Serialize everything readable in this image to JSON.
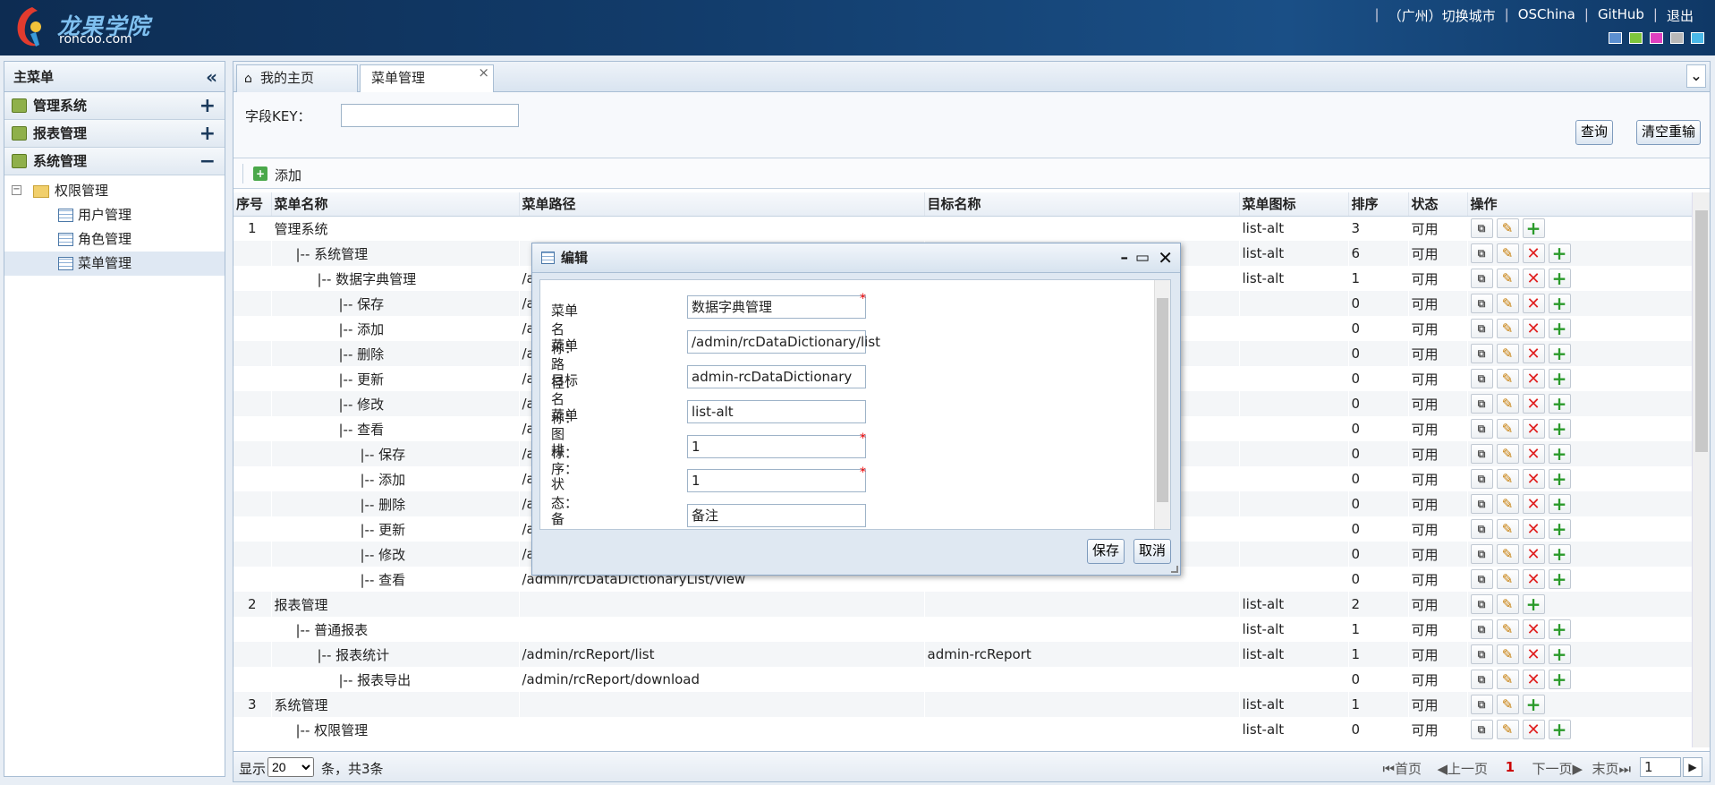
{
  "header": {
    "logo_cn": "龙果学院",
    "logo_en": "roncoo.com",
    "nav": [
      "（广州）切换城市",
      "OSChina",
      "GitHub",
      "退出"
    ],
    "theme_colors": [
      "#5b8fd0",
      "#7ec63c",
      "#e040c0",
      "#b8b8b8",
      "#4ab8e8"
    ]
  },
  "sidebar": {
    "title": "主菜单",
    "groups": [
      {
        "label": "管理系统",
        "toggle": "+"
      },
      {
        "label": "报表管理",
        "toggle": "+"
      },
      {
        "label": "系统管理",
        "toggle": "−"
      }
    ],
    "tree": {
      "root": "权限管理",
      "children": [
        "用户管理",
        "角色管理",
        "菜单管理"
      ]
    }
  },
  "tabs": [
    {
      "label": "我的主页"
    },
    {
      "label": "菜单管理",
      "close": "×"
    }
  ],
  "search": {
    "field_label": "字段KEY：",
    "field_value": "",
    "query_button": "查询",
    "reset_button": "清空重输"
  },
  "toolbar": {
    "add_label": "添加"
  },
  "table": {
    "columns": [
      "序号",
      "菜单名称",
      "菜单路径",
      "目标名称",
      "菜单图标",
      "排序",
      "状态",
      "操作"
    ],
    "rows": [
      {
        "no": "1",
        "name": "管理系统",
        "path": "",
        "target": "",
        "icon": "list-alt",
        "sort": "3",
        "status": "可用",
        "del": false
      },
      {
        "no": "",
        "name": "|-- 系统管理",
        "path": "",
        "target": "",
        "icon": "list-alt",
        "sort": "6",
        "status": "可用",
        "del": true
      },
      {
        "no": "",
        "name": "|-- 数据字典管理",
        "path": "/a",
        "target": "",
        "icon": "list-alt",
        "sort": "1",
        "status": "可用",
        "del": true
      },
      {
        "no": "",
        "name": "|-- 保存",
        "path": "/a",
        "target": "",
        "icon": "",
        "sort": "0",
        "status": "可用",
        "del": true
      },
      {
        "no": "",
        "name": "|-- 添加",
        "path": "/a",
        "target": "",
        "icon": "",
        "sort": "0",
        "status": "可用",
        "del": true
      },
      {
        "no": "",
        "name": "|-- 删除",
        "path": "/a",
        "target": "",
        "icon": "",
        "sort": "0",
        "status": "可用",
        "del": true
      },
      {
        "no": "",
        "name": "|-- 更新",
        "path": "/a",
        "target": "",
        "icon": "",
        "sort": "0",
        "status": "可用",
        "del": true
      },
      {
        "no": "",
        "name": "|-- 修改",
        "path": "/a",
        "target": "",
        "icon": "",
        "sort": "0",
        "status": "可用",
        "del": true
      },
      {
        "no": "",
        "name": "|-- 查看",
        "path": "/a",
        "target": "",
        "icon": "",
        "sort": "0",
        "status": "可用",
        "del": true
      },
      {
        "no": "",
        "name": "|-- 保存",
        "path": "/a",
        "target": "",
        "icon": "",
        "sort": "0",
        "status": "可用",
        "del": true
      },
      {
        "no": "",
        "name": "|-- 添加",
        "path": "/a",
        "target": "",
        "icon": "",
        "sort": "0",
        "status": "可用",
        "del": true
      },
      {
        "no": "",
        "name": "|-- 删除",
        "path": "/a",
        "target": "",
        "icon": "",
        "sort": "0",
        "status": "可用",
        "del": true
      },
      {
        "no": "",
        "name": "|-- 更新",
        "path": "/a",
        "target": "",
        "icon": "",
        "sort": "0",
        "status": "可用",
        "del": true
      },
      {
        "no": "",
        "name": "|-- 修改",
        "path": "/a",
        "target": "",
        "icon": "",
        "sort": "0",
        "status": "可用",
        "del": true
      },
      {
        "no": "",
        "name": "|-- 查看",
        "path": "/admin/rcDataDictionaryList/view",
        "target": "",
        "icon": "",
        "sort": "0",
        "status": "可用",
        "del": true
      },
      {
        "no": "2",
        "name": "报表管理",
        "path": "",
        "target": "",
        "icon": "list-alt",
        "sort": "2",
        "status": "可用",
        "del": false
      },
      {
        "no": "",
        "name": "|-- 普通报表",
        "path": "",
        "target": "",
        "icon": "list-alt",
        "sort": "1",
        "status": "可用",
        "del": true
      },
      {
        "no": "",
        "name": "|-- 报表统计",
        "path": "/admin/rcReport/list",
        "target": "admin-rcReport",
        "icon": "list-alt",
        "sort": "1",
        "status": "可用",
        "del": true
      },
      {
        "no": "",
        "name": "|-- 报表导出",
        "path": "/admin/rcReport/download",
        "target": "",
        "icon": "",
        "sort": "0",
        "status": "可用",
        "del": true
      },
      {
        "no": "3",
        "name": "系统管理",
        "path": "",
        "target": "",
        "icon": "list-alt",
        "sort": "1",
        "status": "可用",
        "del": false
      },
      {
        "no": "",
        "name": "|-- 权限管理",
        "path": "",
        "target": "",
        "icon": "list-alt",
        "sort": "0",
        "status": "可用",
        "del": true
      }
    ]
  },
  "pager": {
    "show_label": "显示",
    "page_size": "20",
    "summary": "条，共3条",
    "first": "首页",
    "prev": "上一页",
    "current": "1",
    "next": "下一页",
    "last": "末页",
    "page_input": "1"
  },
  "dialog": {
    "title": "编辑",
    "fields": [
      {
        "label": "菜单名称：",
        "value": "数据字典管理",
        "required": true
      },
      {
        "label": "菜单路径：",
        "value": "/admin/rcDataDictionary/list",
        "required": false
      },
      {
        "label": "目标名称：",
        "value": "admin-rcDataDictionary",
        "required": false
      },
      {
        "label": "菜单图标：",
        "value": "list-alt",
        "required": false
      },
      {
        "label": "排序：",
        "value": "1",
        "required": true
      },
      {
        "label": "状态：",
        "value": "1",
        "required": true
      },
      {
        "label": "备注：",
        "value": "备注",
        "required": false
      }
    ],
    "save_button": "保存",
    "cancel_button": "取消"
  }
}
